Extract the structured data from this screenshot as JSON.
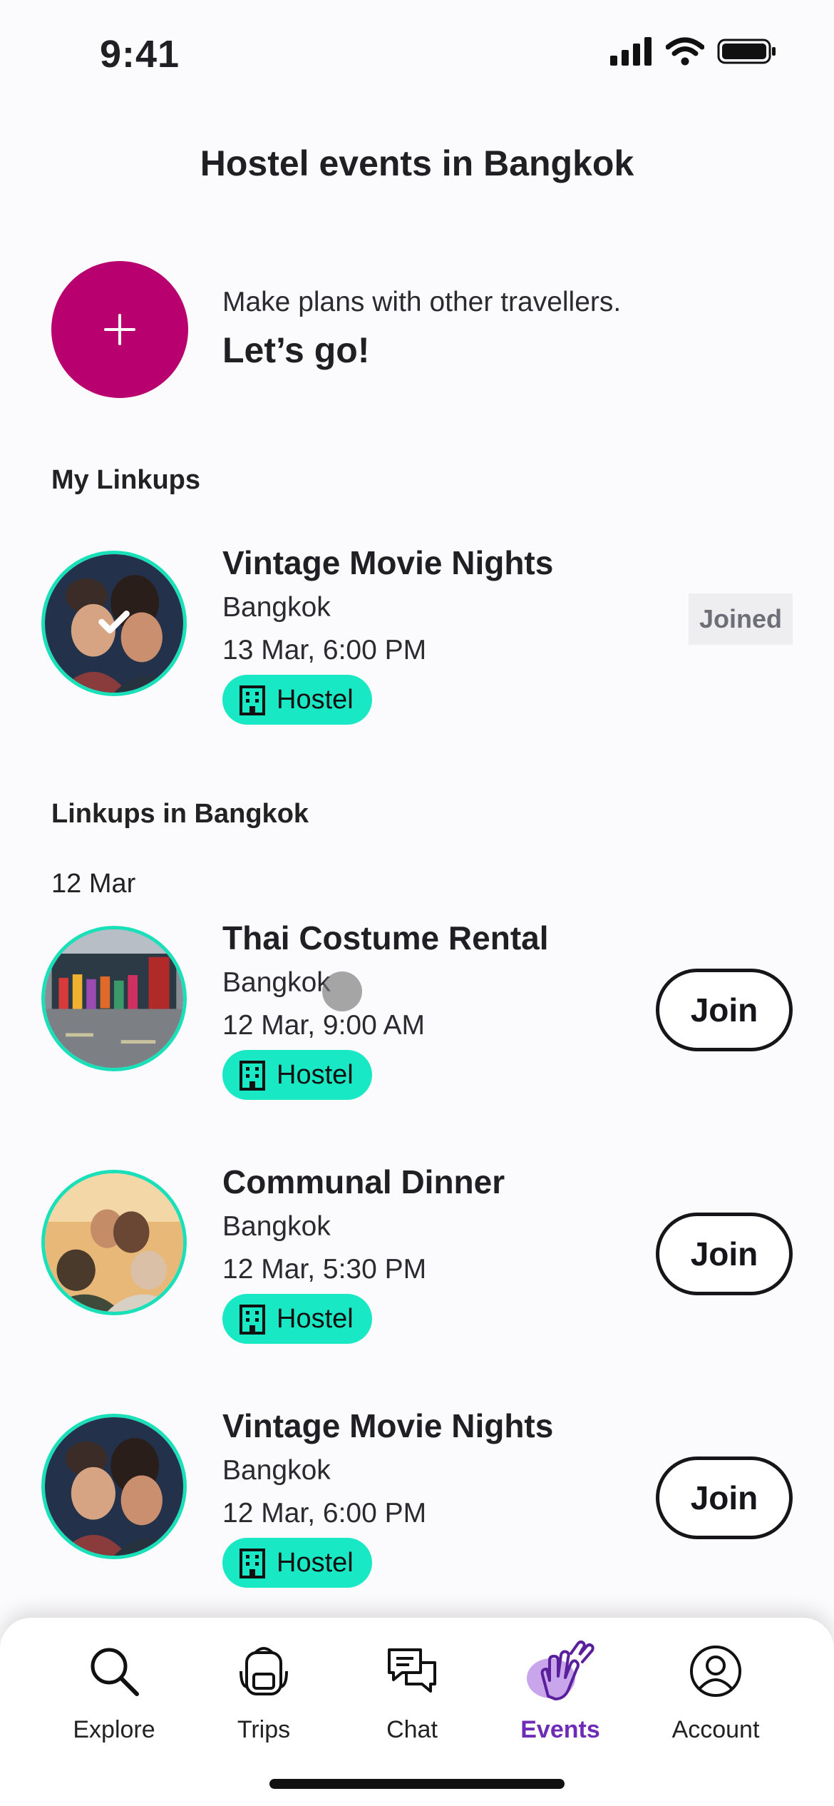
{
  "status_bar": {
    "time": "9:41"
  },
  "header": {
    "title": "Hostel events in Bangkok"
  },
  "promo": {
    "subtitle": "Make plans with other travellers.",
    "cta": "Let’s go!"
  },
  "my_linkups": {
    "heading": "My Linkups",
    "items": [
      {
        "title": "Vintage Movie Nights",
        "city": "Bangkok",
        "datetime": "13 Mar, 6:00 PM",
        "tag": "Hostel",
        "status": "Joined"
      }
    ]
  },
  "linkups": {
    "heading": "Linkups in Bangkok",
    "date_group": "12 Mar",
    "items": [
      {
        "title": "Thai Costume Rental",
        "city": "Bangkok",
        "datetime": "12 Mar, 9:00 AM",
        "tag": "Hostel",
        "action": "Join"
      },
      {
        "title": "Communal Dinner",
        "city": "Bangkok",
        "datetime": "12 Mar, 5:30 PM",
        "tag": "Hostel",
        "action": "Join"
      },
      {
        "title": "Vintage Movie Nights",
        "city": "Bangkok",
        "datetime": "12 Mar, 6:00 PM",
        "tag": "Hostel",
        "action": "Join"
      }
    ]
  },
  "tabbar": {
    "items": [
      {
        "label": "Explore",
        "icon": "search-icon"
      },
      {
        "label": "Trips",
        "icon": "backpack-icon"
      },
      {
        "label": "Chat",
        "icon": "chat-icon"
      },
      {
        "label": "Events",
        "icon": "waving-hands-icon",
        "active": true
      },
      {
        "label": "Account",
        "icon": "user-icon"
      }
    ]
  },
  "colors": {
    "accent": "#b8006e",
    "tag": "#19e8c4",
    "active_tab": "#6d2bb6"
  }
}
